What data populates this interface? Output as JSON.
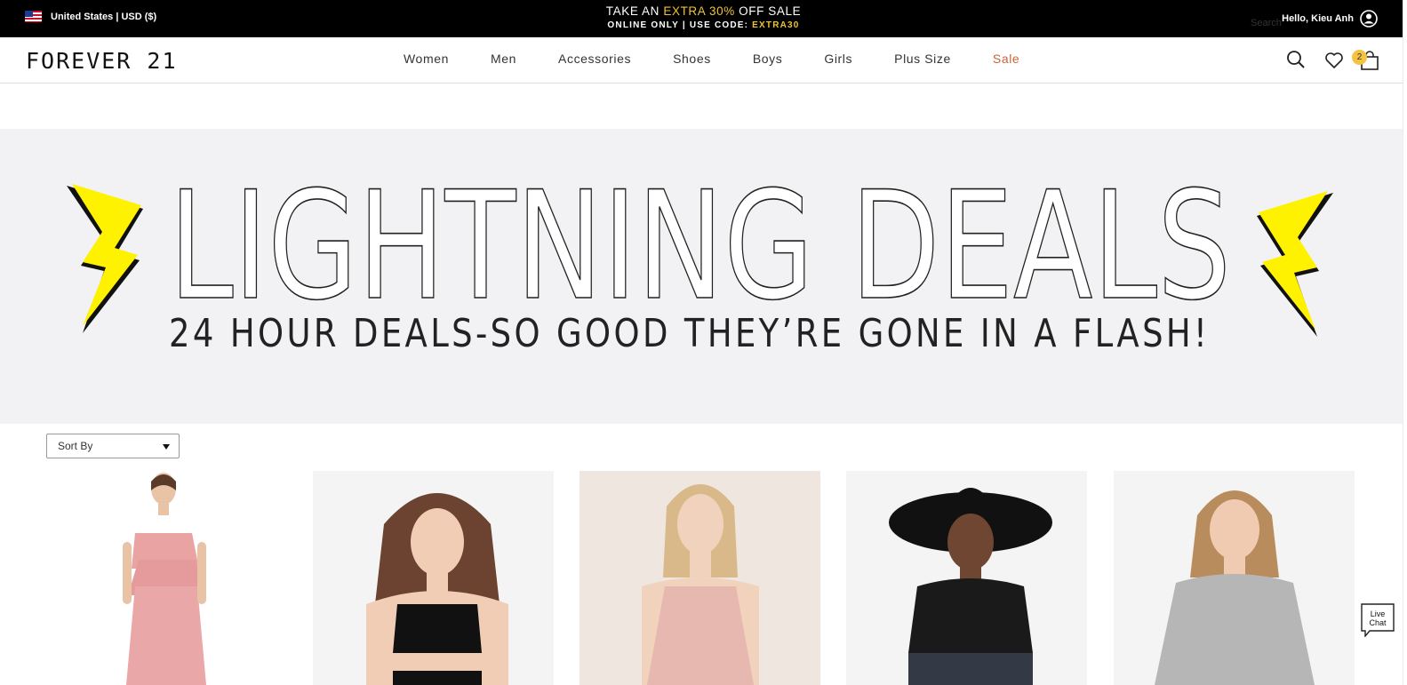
{
  "topbar": {
    "locale": "United States | USD ($)",
    "promo_take": "TAKE AN ",
    "promo_extra": "EXTRA 30%",
    "promo_off": " OFF SALE",
    "promo_code_prefix": "ONLINE ONLY | USE CODE: ",
    "promo_code": "EXTRA30",
    "greeting": "Hello, Kieu Anh"
  },
  "header": {
    "logo": "FOREVER 21",
    "nav": [
      "Women",
      "Men",
      "Accessories",
      "Shoes",
      "Boys",
      "Girls",
      "Plus Size",
      "Sale"
    ],
    "search_label": "Search",
    "bag_count": "2"
  },
  "banner": {
    "title": "LIGHTNING DEALS",
    "subtitle": "24 HOUR DEALS-SO GOOD THEY’RE GONE IN A FLASH!"
  },
  "sort": {
    "label": "Sort By"
  },
  "livechat": {
    "line1": "Live",
    "line2": "Chat"
  },
  "colors": {
    "sale": "#c8653a",
    "promo_gold": "#f1c232",
    "bolt": "#fff200"
  }
}
